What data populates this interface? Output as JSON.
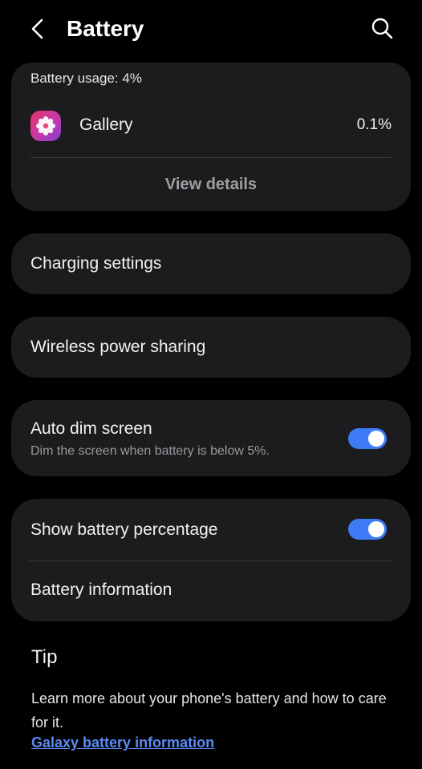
{
  "header": {
    "title": "Battery",
    "back_icon": "chevron-left-icon",
    "search_icon": "search-icon"
  },
  "usage": {
    "header": "Battery usage: 4%",
    "apps": [
      {
        "name": "Gallery",
        "percent": "0.1%",
        "icon": "gallery-flower-icon"
      }
    ],
    "view_details": "View details"
  },
  "settings": {
    "charging": "Charging settings",
    "wireless": "Wireless power sharing",
    "auto_dim": {
      "label": "Auto dim screen",
      "sub": "Dim the screen when battery is below 5%.",
      "enabled": true
    },
    "show_percentage": {
      "label": "Show battery percentage",
      "enabled": true
    },
    "battery_info": "Battery information"
  },
  "tip": {
    "title": "Tip",
    "body": "Learn more about your phone's battery and how to care for it.",
    "link": "Galaxy battery information"
  },
  "colors": {
    "background": "#000000",
    "card": "#1c1c1e",
    "accent": "#3e7bf6",
    "link": "#5b8cf5"
  }
}
